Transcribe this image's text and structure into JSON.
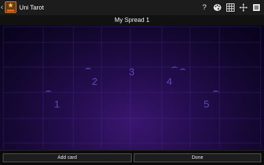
{
  "app": {
    "title": "Uni Tarot"
  },
  "actionbar": {
    "help_label": "?"
  },
  "spread": {
    "name": "My Spread 1"
  },
  "cards": [
    {
      "label": "1"
    },
    {
      "label": "2"
    },
    {
      "label": "3"
    },
    {
      "label": "4"
    },
    {
      "label": "5"
    }
  ],
  "buttons": {
    "add_card": "Add card",
    "done": "Done"
  },
  "colors": {
    "board_center": "#3a1670",
    "board_edge": "#07031a",
    "card_number": "#5b48b8",
    "actionbar": "#1c1c1c"
  },
  "icons": [
    "back-icon",
    "app-logo-icon",
    "help-icon",
    "palette-icon",
    "grid-icon",
    "move-arrows-icon",
    "menu-overflow-icon"
  ]
}
